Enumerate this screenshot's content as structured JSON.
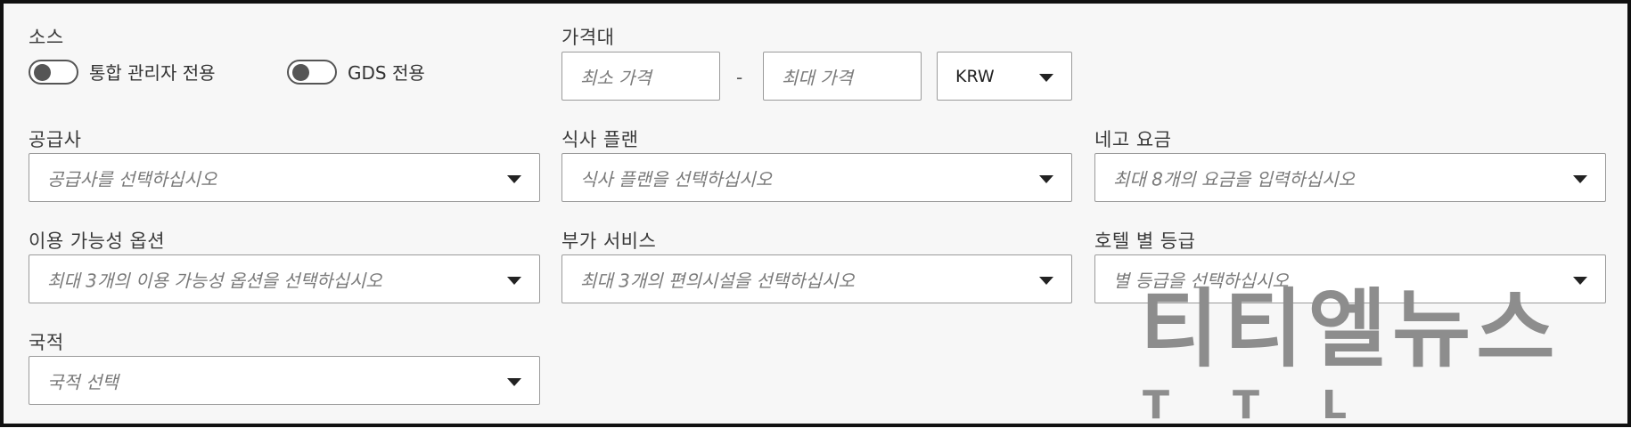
{
  "source": {
    "label": "소스",
    "toggles": [
      {
        "label": "통합 관리자 전용",
        "on": false
      },
      {
        "label": "GDS 전용",
        "on": false
      }
    ]
  },
  "price": {
    "label": "가격대",
    "min_placeholder": "최소 가격",
    "separator": "-",
    "max_placeholder": "최대 가격",
    "currency": "KRW"
  },
  "supplier": {
    "label": "공급사",
    "placeholder": "공급사를 선택하십시오"
  },
  "meal_plan": {
    "label": "식사 플랜",
    "placeholder": "식사 플랜을 선택하십시오"
  },
  "negotiated_rate": {
    "label": "네고 요금",
    "placeholder": "최대 8개의 요금을 입력하십시오"
  },
  "availability": {
    "label": "이용 가능성 옵션",
    "placeholder": "최대 3개의 이용 가능성 옵션을 선택하십시오"
  },
  "amenities": {
    "label": "부가 서비스",
    "placeholder": "최대 3개의 편의시설을 선택하십시오"
  },
  "hotel_rating": {
    "label": "호텔 별 등급",
    "placeholder": "별 등급을 선택하십시오"
  },
  "nationality": {
    "label": "국적",
    "placeholder": "국적 선택"
  },
  "watermark": {
    "main": "티티엘뉴스",
    "sub": "TTL"
  }
}
